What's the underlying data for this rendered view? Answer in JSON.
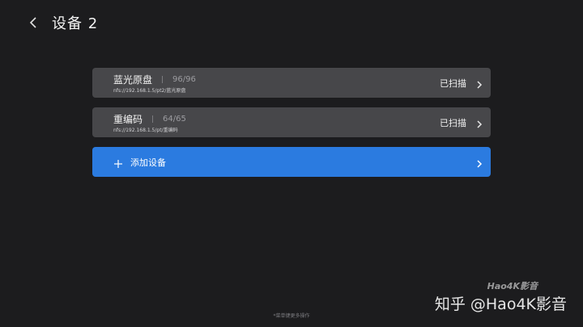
{
  "header": {
    "title": "设备 2",
    "back_icon": "chevron-left-icon"
  },
  "devices": [
    {
      "name": "蓝光原盘",
      "count": "96/96",
      "path": "nfs://192.168.1.5/pt2/蓝光原盘",
      "status": "已扫描"
    },
    {
      "name": "重编码",
      "count": "64/65",
      "path": "nfs://192.168.1.5/pt/重编码",
      "status": "已扫描"
    }
  ],
  "add_device": {
    "label": "添加设备",
    "icon": "plus-icon"
  },
  "footer": {
    "hint": "*菜单键更多操作"
  },
  "watermark": {
    "text": "知乎 @Hao4K影音",
    "logo": "Hao4K影音"
  },
  "colors": {
    "background": "#1c1c1e",
    "card": "#47474a",
    "accent": "#2b7be0"
  }
}
